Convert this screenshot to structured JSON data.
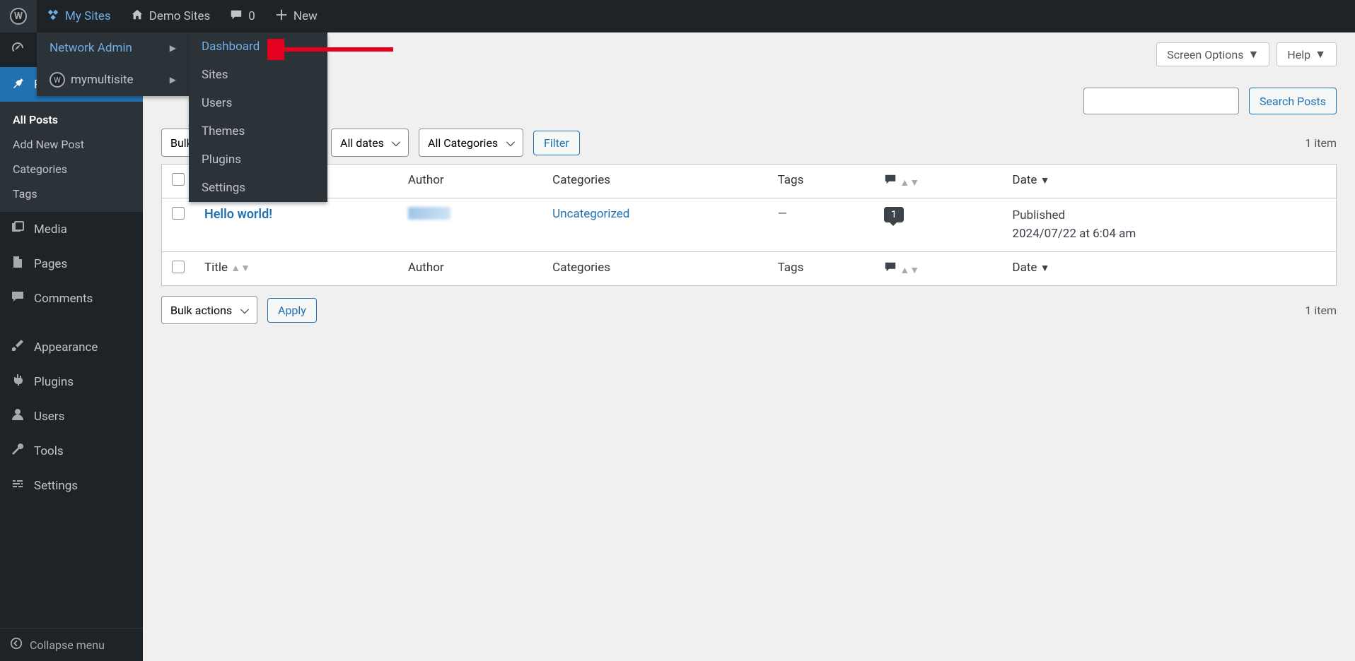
{
  "adminbar": {
    "my_sites": "My Sites",
    "demo_sites": "Demo Sites",
    "comments_count": "0",
    "new": "New"
  },
  "flyout": {
    "network_admin": "Network Admin",
    "site_name": "mymultisite",
    "sub": {
      "dashboard": "Dashboard",
      "sites": "Sites",
      "users": "Users",
      "themes": "Themes",
      "plugins": "Plugins",
      "settings": "Settings"
    }
  },
  "top_buttons": {
    "screen_options": "Screen Options",
    "help": "Help"
  },
  "sidebar": {
    "dashboard": "Dashboard",
    "posts": "Posts",
    "posts_sub": {
      "all_posts": "All Posts",
      "add_new": "Add New Post",
      "categories": "Categories",
      "tags": "Tags"
    },
    "media": "Media",
    "pages": "Pages",
    "comments": "Comments",
    "appearance": "Appearance",
    "plugins": "Plugins",
    "users": "Users",
    "tools": "Tools",
    "settings": "Settings",
    "collapse": "Collapse menu"
  },
  "search": {
    "button": "Search Posts"
  },
  "filters": {
    "bulk_actions": "Bulk actions",
    "all_dates": "All dates",
    "all_categories": "All Categories",
    "filter": "Filter",
    "apply": "Apply"
  },
  "item_count": "1 item",
  "table": {
    "columns": {
      "title": "Title",
      "author": "Author",
      "categories": "Categories",
      "tags": "Tags",
      "date": "Date"
    },
    "rows": [
      {
        "title": "Hello world!",
        "category": "Uncategorized",
        "tags": "—",
        "comments": "1",
        "date_status": "Published",
        "date_value": "2024/07/22 at 6:04 am"
      }
    ]
  }
}
